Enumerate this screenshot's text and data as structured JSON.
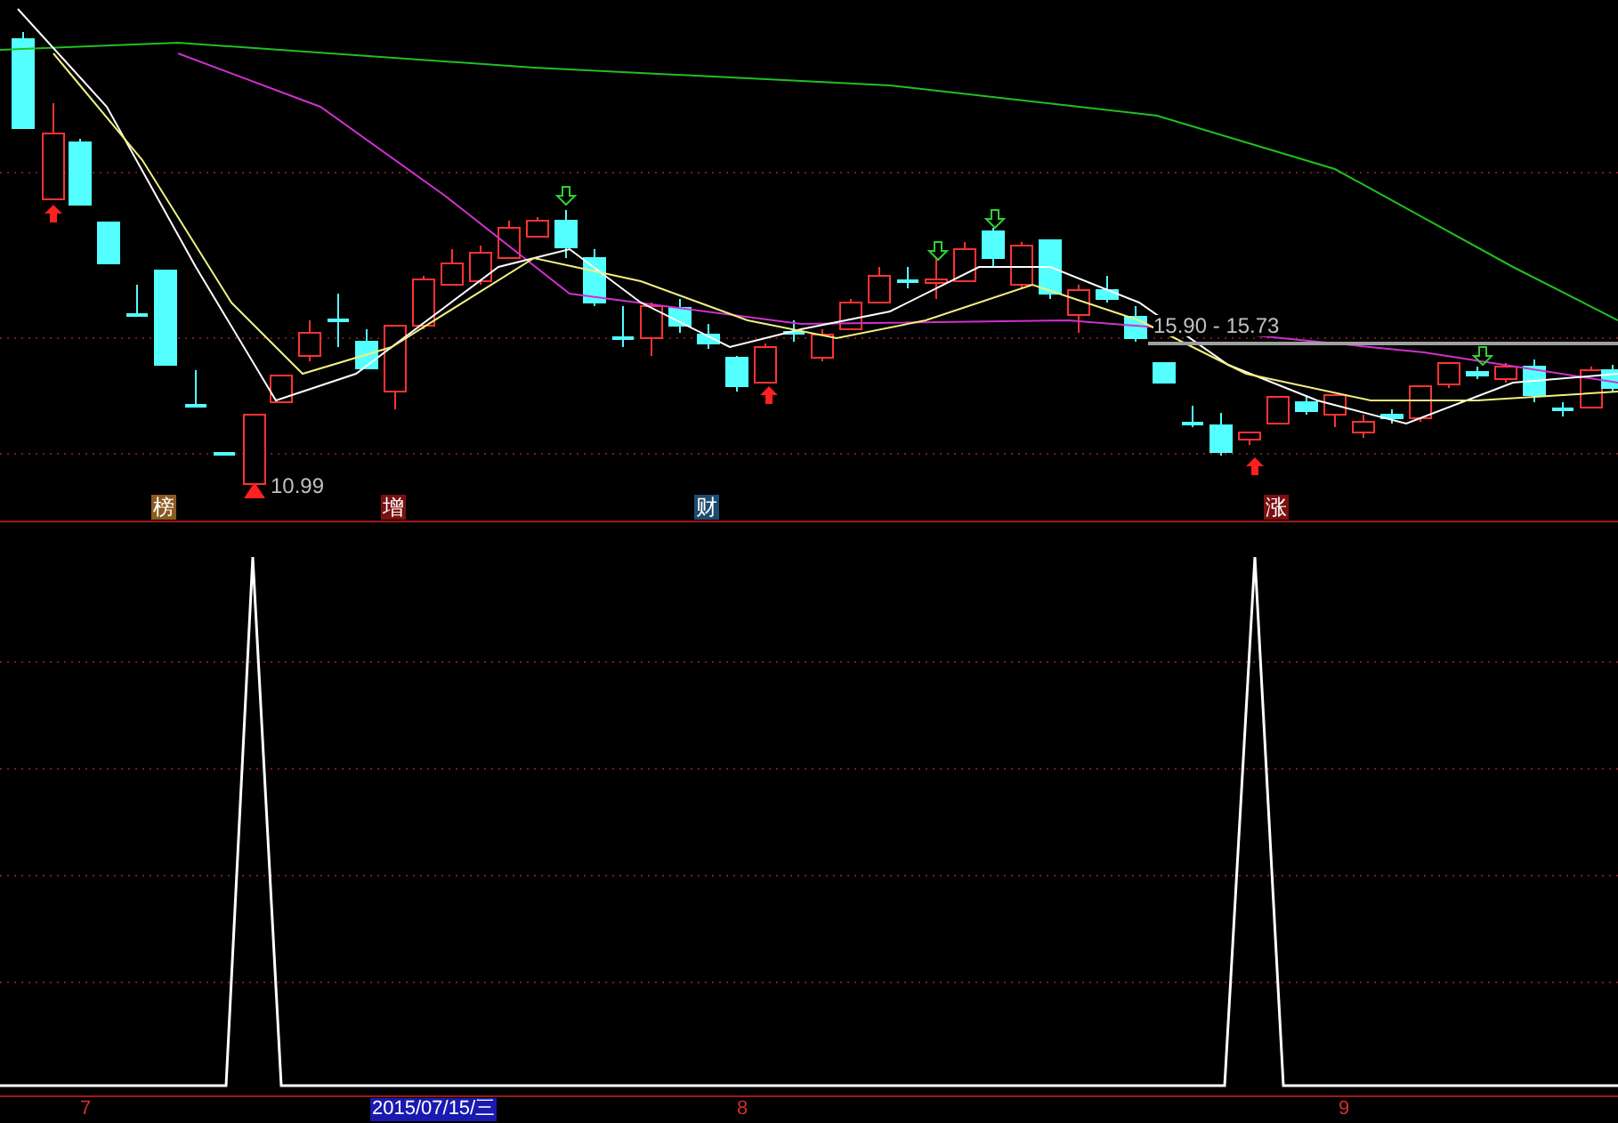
{
  "price_panel": {
    "low_label": "10.99",
    "range_label": "15.90 - 15.73",
    "tags": [
      {
        "text": "榜",
        "color": "#8a5a1e"
      },
      {
        "text": "增",
        "color": "#7a1010"
      },
      {
        "text": "财",
        "color": "#1e4a6e"
      },
      {
        "text": "涨",
        "color": "#7a1010"
      }
    ]
  },
  "time_axis": {
    "labels": [
      {
        "text": "7",
        "selected": false
      },
      {
        "text": "2015/07/15/三",
        "selected": true
      },
      {
        "text": "8",
        "selected": false
      },
      {
        "text": "9",
        "selected": false
      }
    ]
  }
}
